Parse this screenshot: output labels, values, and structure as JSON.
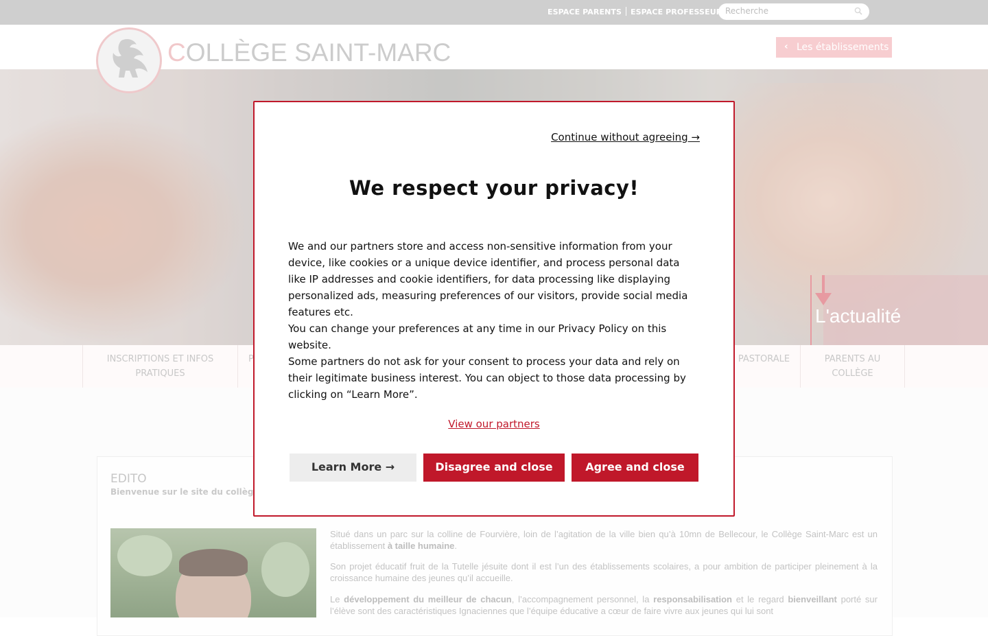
{
  "topbar": {
    "links": [
      "ESPACE PARENTS",
      "ESPACE PROFESSEURS"
    ],
    "search_placeholder": "Recherche"
  },
  "header": {
    "title_first": "C",
    "title_rest": "OLLÈGE SAINT-MARC",
    "etablissements_label": "Les établissements"
  },
  "hero": {
    "actualite": "L'actualité"
  },
  "nav": {
    "items": [
      {
        "line1": "INSCRIPTIONS ET INFOS",
        "line2": "PRATIQUES"
      },
      {
        "line1": "P",
        "line2": ""
      },
      {
        "line1": "PASTORALE",
        "line2": ""
      },
      {
        "line1": "PARENTS AU",
        "line2": "COLLÈGE"
      }
    ]
  },
  "content": {
    "edito_title": "EDITO",
    "edito_subtitle": "Bienvenue sur le site du collège",
    "p1_a": "Situé dans un parc sur la colline de Fourvière, loin de l’agitation de la ville bien qu’à 10mn de Bellecour, le Collège Saint-Marc est un établissement ",
    "p1_b": "à taille humaine",
    "p1_c": ".",
    "p2": "Son projet éducatif fruit de la Tutelle jésuite dont il est l’un des établissements scolaires, a pour ambition de participer pleinement à la croissance humaine des jeunes qu’il accueille.",
    "p3_a": "Le ",
    "p3_b": "développement du meilleur de chacun",
    "p3_c": ", l’accompagnement personnel, la ",
    "p3_d": "responsabilisation",
    "p3_e": " et le regard ",
    "p3_f": "bienveillant",
    "p3_g": " porté sur l’élève  sont des caractéristiques Ignaciennes que l’équipe éducative a cœur de faire vivre aux jeunes qui lui sont"
  },
  "modal": {
    "continue_label": "Continue without agreeing →",
    "title": "We respect your privacy!",
    "body": [
      "We and our partners store and access non-sensitive information from your device, like cookies or a unique device identifier, and process personal data like IP addresses and cookie identifiers, for data processing like displaying personalized ads, measuring preferences of our visitors, provide social media features etc.",
      "You can change your preferences at any time in our Privacy Policy on this website.",
      "Some partners do not ask for your consent to process your data and rely on their legitimate business interest. You can object to those data processing by clicking on “Learn More”."
    ],
    "partners_link": "View our partners",
    "learn_more": "Learn More →",
    "disagree": "Disagree and close",
    "agree": "Agree and close"
  },
  "colors": {
    "accent": "#c0182a",
    "topbar": "#cfcfcf"
  }
}
